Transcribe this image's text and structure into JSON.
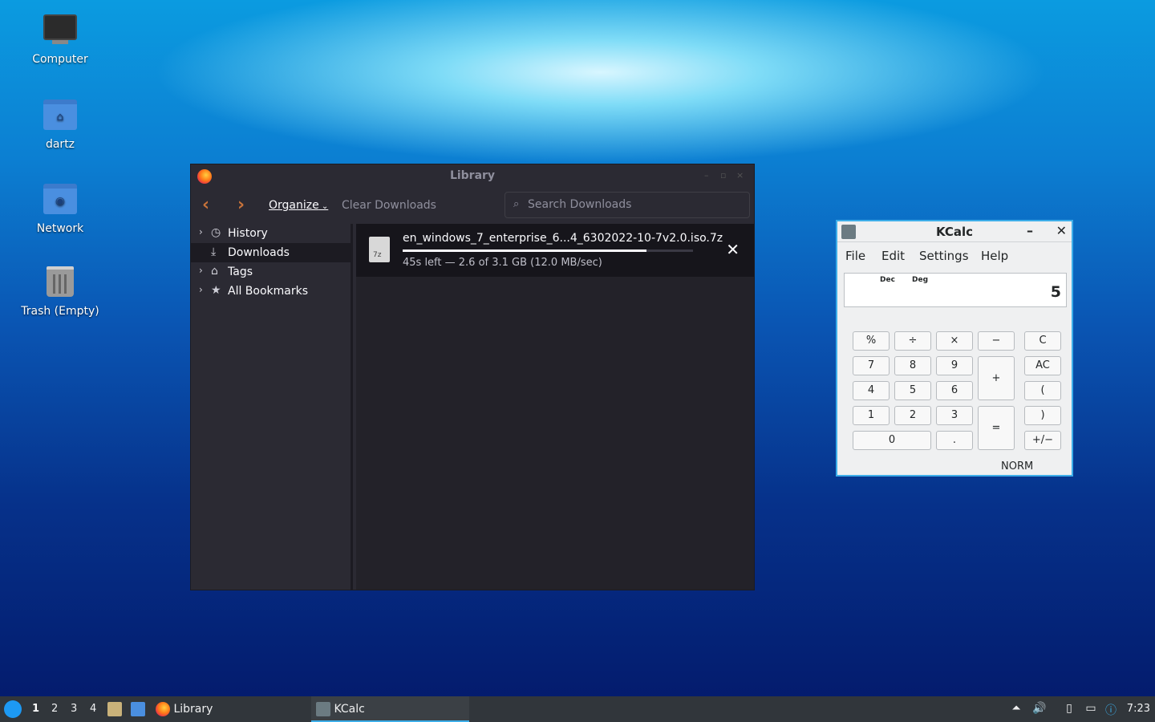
{
  "desktop": {
    "icons": [
      {
        "label": "Computer"
      },
      {
        "label": "dartz"
      },
      {
        "label": "Network"
      },
      {
        "label": "Trash (Empty)"
      }
    ]
  },
  "library": {
    "title": "Library",
    "toolbar": {
      "organize_label": "Organize",
      "clear_label": "Clear Downloads",
      "search_placeholder": "Search Downloads"
    },
    "sidebar": [
      {
        "label": "History"
      },
      {
        "label": "Downloads"
      },
      {
        "label": "Tags"
      },
      {
        "label": "All Bookmarks"
      }
    ],
    "download": {
      "filename": "en_windows_7_enterprise_6...4_6302022-10-7v2.0.iso.7z",
      "status": "45s left — 2.6 of 3.1 GB (12.0 MB/sec)",
      "progress": 0.84
    }
  },
  "kcalc": {
    "title": "KCalc",
    "menu": [
      "File",
      "Edit",
      "Settings",
      "Help"
    ],
    "indicators": [
      "Dec",
      "Deg"
    ],
    "display_value": "5",
    "buttons": {
      "percent": "%",
      "divide": "÷",
      "multiply": "×",
      "minus": "−",
      "clear": "C",
      "seven": "7",
      "eight": "8",
      "nine": "9",
      "plus": "+",
      "all_clear": "AC",
      "four": "4",
      "five": "5",
      "six": "6",
      "open_paren": "(",
      "one": "1",
      "two": "2",
      "three": "3",
      "equals": "=",
      "close_paren": ")",
      "zero": "0",
      "decimal": ".",
      "sign": "+/−"
    },
    "mode": "NORM"
  },
  "taskbar": {
    "workspaces": [
      "1",
      "2",
      "3",
      "4"
    ],
    "tasks": [
      {
        "label": "Library"
      },
      {
        "label": "KCalc"
      }
    ],
    "clock": "7:23"
  }
}
